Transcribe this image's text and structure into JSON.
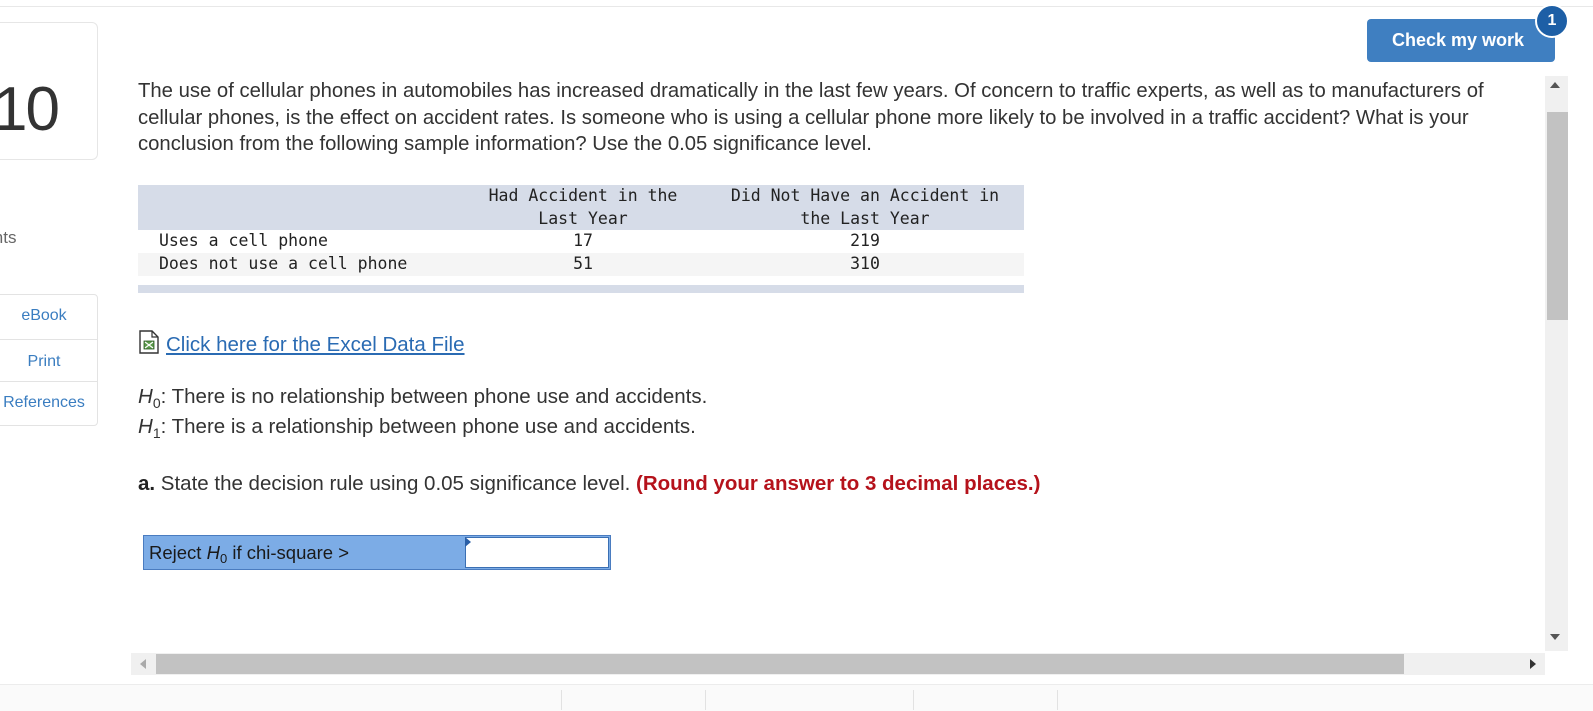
{
  "question_number": "10",
  "sidebar": {
    "points_label": "ints",
    "links": [
      "eBook",
      "Print",
      "References"
    ]
  },
  "header": {
    "check_button": "Check my work",
    "badge_count": "1"
  },
  "question_text": "The use of cellular phones in automobiles has increased dramatically in the last few years. Of concern to traffic experts, as well as to manufacturers of cellular phones, is the effect on accident rates. Is someone who is using a cellular phone more likely to be involved in a traffic accident? What is your conclusion from the following sample information? Use the 0.05 significance level.",
  "table": {
    "headers": [
      "",
      "Had Accident in the\nLast Year",
      "Did Not Have an Accident in\nthe Last Year"
    ],
    "rows": [
      [
        "Uses a cell phone",
        "17",
        "219"
      ],
      [
        "Does not use a cell phone",
        "51",
        "310"
      ]
    ]
  },
  "excel_link": "Click here for the Excel Data File",
  "hypotheses": {
    "h0_symbol": "H",
    "h0_sub": "0",
    "h0_text": ": There is no relationship between phone use and accidents.",
    "h1_symbol": "H",
    "h1_sub": "1",
    "h1_text": ": There is a relationship between phone use and accidents."
  },
  "part_a": {
    "label": "a.",
    "text": " State the decision rule using 0.05 significance level. ",
    "note": "(Round your answer to 3 decimal places.)"
  },
  "answer": {
    "prefix": "Reject ",
    "h_symbol": "H",
    "h_sub": "0",
    "suffix": " if chi-square >",
    "value": ""
  },
  "colors": {
    "accent": "#3f7fc1",
    "badge": "#1d5fa6",
    "note_red": "#b5121b",
    "answer_bg": "#7cace6",
    "table_header": "#d6dce8"
  },
  "icons": [
    "file-icon",
    "scroll-up-icon",
    "scroll-down-icon",
    "scroll-left-icon",
    "scroll-right-icon"
  ]
}
